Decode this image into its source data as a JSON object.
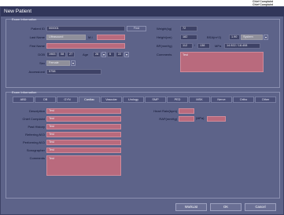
{
  "brand": {
    "line1": "Chief Complaint",
    "line2": "Chief Complaint"
  },
  "window": {
    "title": "New Patient"
  },
  "exam_info": {
    "title": "Exam Information",
    "patient_id": {
      "label": "Patient ID",
      "value": "000001"
    },
    "find_button": "Find",
    "last_name": {
      "label": "Last Name",
      "value": "Ultrasound"
    },
    "mi_label": "M.I",
    "first_name": {
      "label": "First Name",
      "value": ""
    },
    "dob": {
      "label": "DOB",
      "year": "1983",
      "month": "08",
      "day": "27"
    },
    "age": {
      "label": "Age",
      "value": "28",
      "unit_value": "6",
      "extra": "22"
    },
    "sex": {
      "label": "Sex",
      "value": "Female"
    },
    "accession": {
      "label": "Accession#",
      "value": "5758"
    },
    "weight": {
      "label": "Weight(kg)",
      "value": "72"
    },
    "height": {
      "label": "Height(cm)",
      "value": "182"
    },
    "bsa": {
      "label": "BSA(m^2)",
      "value": "1.90",
      "method": "System"
    },
    "bp": {
      "label": "BP(mmHg)",
      "systolic": "112",
      "sep": "/",
      "diastolic": "138",
      "map_label": "MPa",
      "map_value": "14.922 / 18.408"
    },
    "comments": {
      "label": "Comments",
      "value": "Test"
    }
  },
  "exam_info2": {
    "title": "Exam Information",
    "tabs": [
      "ABD",
      "OB",
      "GYN",
      "Cardiac",
      "Vascular",
      "Urology",
      "SMP",
      "PED",
      "MSK",
      "Nerve",
      "Ortho",
      "Other"
    ],
    "active_tab": "Cardiac",
    "description": {
      "label": "Description",
      "value": "Test"
    },
    "chief_complaint": {
      "label": "Chief Complaint",
      "value": "Test"
    },
    "past_history": {
      "label": "Past History",
      "value": "Test"
    },
    "referring_md": {
      "label": "Referring.M.D",
      "value": "Test"
    },
    "performing_md": {
      "label": "Performing.M.D",
      "value": "Test"
    },
    "sonographer": {
      "label": "Sonographer",
      "value": "Test"
    },
    "comments": {
      "label": "Comments",
      "value": "Test"
    },
    "heart_rate": {
      "label": "Heart Rate(bpm)",
      "value": ""
    },
    "rap": {
      "label": "RAP(mmHg)",
      "value": "",
      "unit": "(MPa)"
    }
  },
  "buttons": {
    "worklist": "WorkList",
    "ok": "OK",
    "cancel": "Cancel"
  }
}
